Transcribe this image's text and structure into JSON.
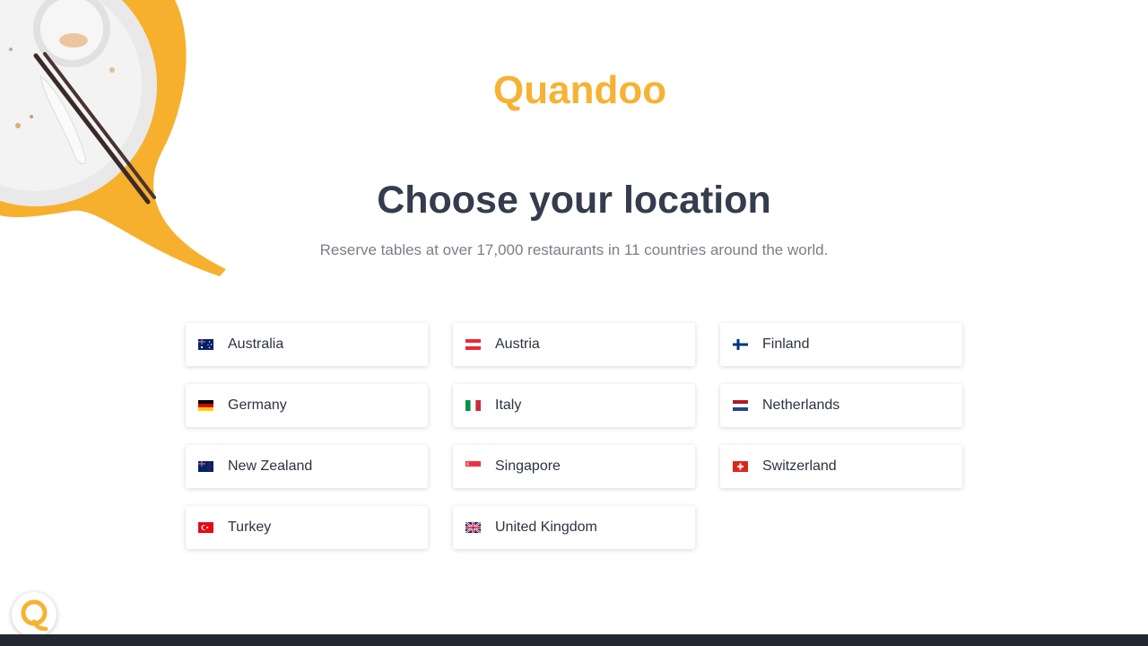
{
  "brand": {
    "name": "Quandoo",
    "color": "#f7b233"
  },
  "header": {
    "title": "Choose your location",
    "subtitle": "Reserve tables at over 17,000 restaurants in 11 countries around the world."
  },
  "countries": [
    {
      "label": "Australia",
      "icon": "australia-flag-icon"
    },
    {
      "label": "Austria",
      "icon": "austria-flag-icon"
    },
    {
      "label": "Finland",
      "icon": "finland-flag-icon"
    },
    {
      "label": "Germany",
      "icon": "germany-flag-icon"
    },
    {
      "label": "Italy",
      "icon": "italy-flag-icon"
    },
    {
      "label": "Netherlands",
      "icon": "netherlands-flag-icon"
    },
    {
      "label": "New Zealand",
      "icon": "new-zealand-flag-icon"
    },
    {
      "label": "Singapore",
      "icon": "singapore-flag-icon"
    },
    {
      "label": "Switzerland",
      "icon": "switzerland-flag-icon"
    },
    {
      "label": "Turkey",
      "icon": "turkey-flag-icon"
    },
    {
      "label": "United Kingdom",
      "icon": "united-kingdom-flag-icon"
    }
  ],
  "colors": {
    "title": "#343c4e",
    "subtitle": "#7a7f88",
    "footer": "#222831"
  }
}
